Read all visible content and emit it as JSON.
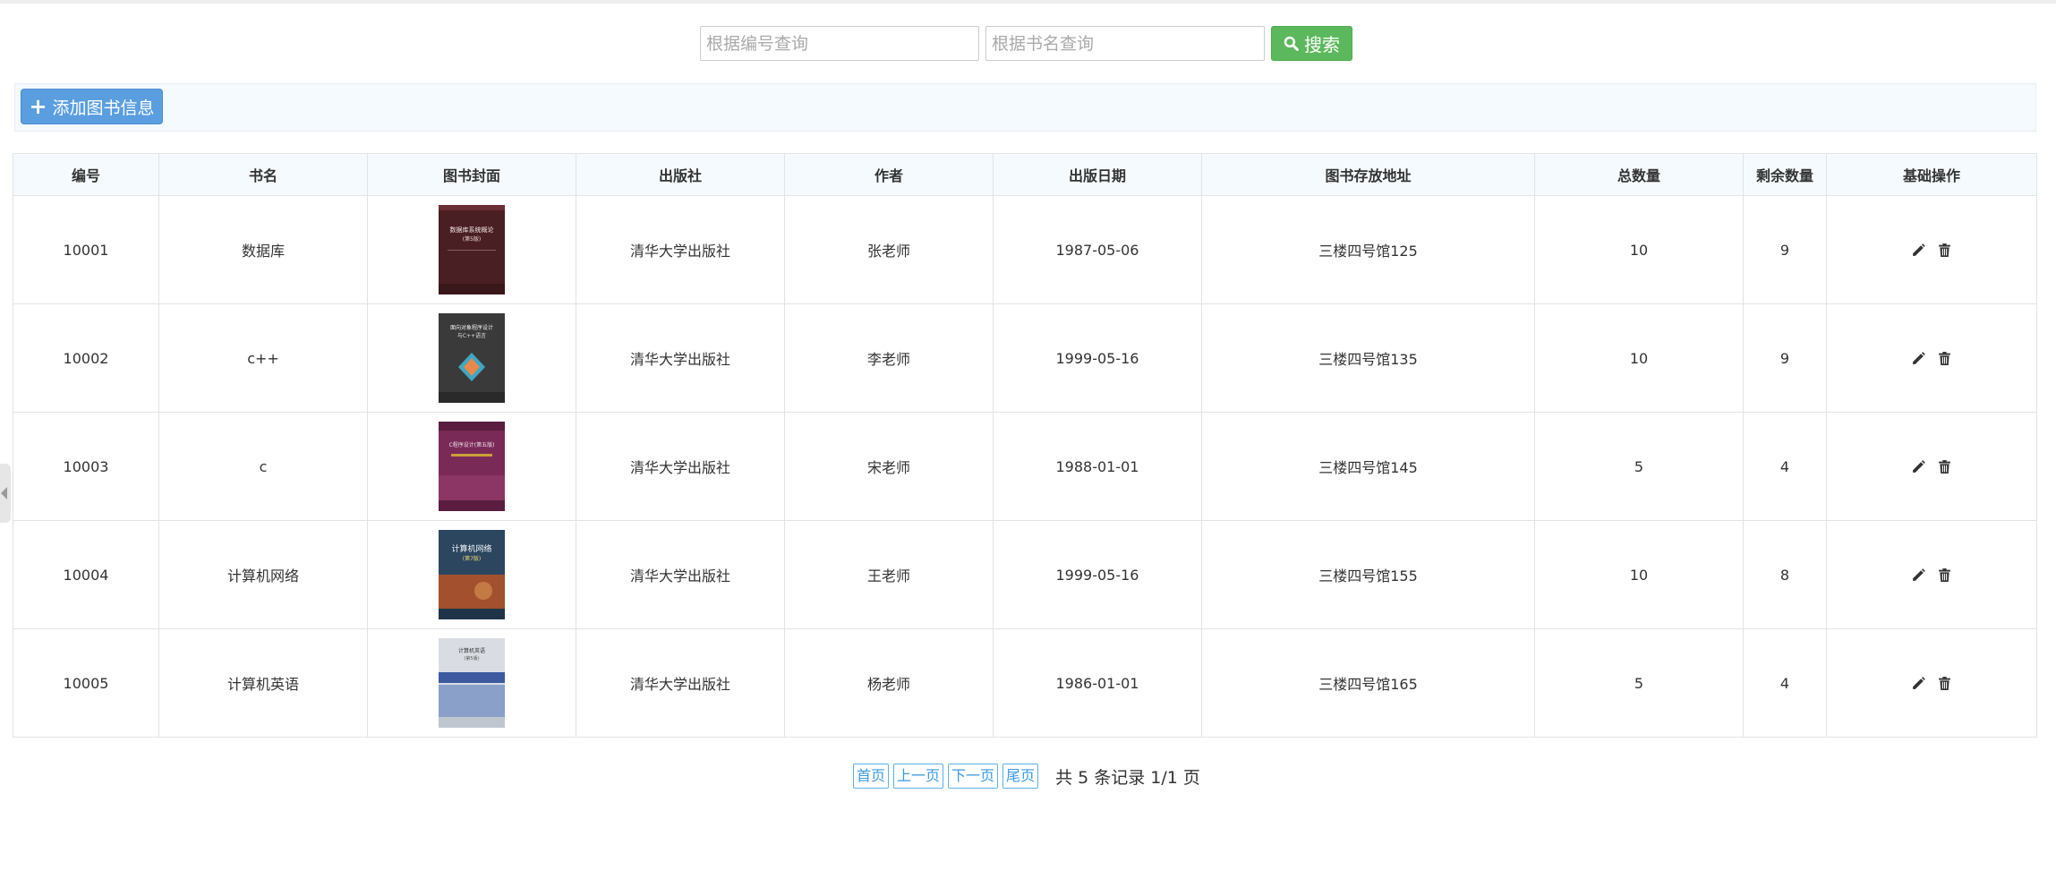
{
  "search": {
    "id_placeholder": "根据编号查询",
    "name_placeholder": "根据书名查询",
    "button_label": "搜索"
  },
  "toolbar": {
    "add_label": "添加图书信息"
  },
  "table": {
    "headers": [
      "编号",
      "书名",
      "图书封面",
      "出版社",
      "作者",
      "出版日期",
      "图书存放地址",
      "总数量",
      "剩余数量",
      "基础操作"
    ],
    "rows": [
      {
        "id": "10001",
        "name": "数据库",
        "publisher": "清华大学出版社",
        "author": "张老师",
        "date": "1987-05-06",
        "location": "三楼四号馆125",
        "total": "10",
        "remaining": "9",
        "cover_title": "数据库系统概论",
        "cover_sub": "(第5版)"
      },
      {
        "id": "10002",
        "name": "c++",
        "publisher": "清华大学出版社",
        "author": "李老师",
        "date": "1999-05-16",
        "location": "三楼四号馆135",
        "total": "10",
        "remaining": "9",
        "cover_title": "面向对象程序设计",
        "cover_sub": "与C++语言"
      },
      {
        "id": "10003",
        "name": "c",
        "publisher": "清华大学出版社",
        "author": "宋老师",
        "date": "1988-01-01",
        "location": "三楼四号馆145",
        "total": "5",
        "remaining": "4",
        "cover_title": "C程序设计(第五版)",
        "cover_sub": ""
      },
      {
        "id": "10004",
        "name": "计算机网络",
        "publisher": "清华大学出版社",
        "author": "王老师",
        "date": "1999-05-16",
        "location": "三楼四号馆155",
        "total": "10",
        "remaining": "8",
        "cover_title": "计算机网络",
        "cover_sub": "(第7版)"
      },
      {
        "id": "10005",
        "name": "计算机英语",
        "publisher": "清华大学出版社",
        "author": "杨老师",
        "date": "1986-01-01",
        "location": "三楼四号馆165",
        "total": "5",
        "remaining": "4",
        "cover_title": "计算机英语",
        "cover_sub": "(第5版)"
      }
    ]
  },
  "pager": {
    "first": "首页",
    "prev": "上一页",
    "next": "下一页",
    "last": "尾页",
    "info": "共 5 条记录 1/1 页"
  },
  "icons": {
    "search": "search-icon",
    "add": "plus-icon",
    "edit": "pencil-icon",
    "delete": "trash-icon"
  },
  "colors": {
    "search_button": "#5cb85c",
    "add_button": "#5a9ee0",
    "pager_link": "#3a9ae0",
    "header_bg": "#f5fafe"
  }
}
